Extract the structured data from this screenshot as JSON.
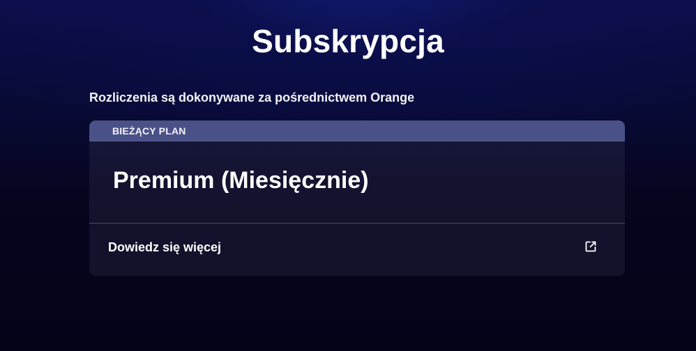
{
  "page": {
    "title": "Subskrypcja",
    "billing_note": "Rozliczenia są dokonywane za pośrednictwem Orange"
  },
  "plan_card": {
    "header_label": "BIEŻĄCY PLAN",
    "plan_name": "Premium (Miesięcznie)",
    "learn_more_label": "Dowiedz się więcej",
    "learn_more_icon": "external-link-icon"
  },
  "colors": {
    "background": "#040318",
    "card_header": "#4a5187",
    "card_body": "#131330"
  }
}
